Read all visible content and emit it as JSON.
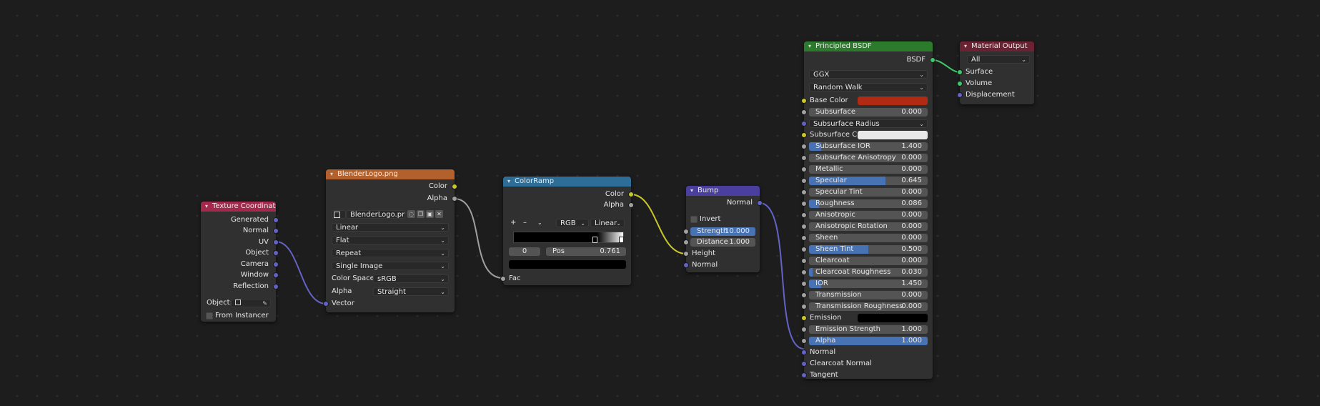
{
  "colors": {
    "background": "#1d1d1d",
    "header_input": "#a3294d",
    "header_texture": "#b3612c",
    "header_converter": "#2d6d96",
    "header_vector": "#4a3f9e",
    "header_shader": "#2c7a2c",
    "header_output": "#6b2232",
    "accent_blue": "#4772b3",
    "base_color": "#b12a14",
    "wire_gray": "#a0a0a0",
    "wire_yellow": "#c7c729",
    "wire_purple": "#6363c7",
    "wire_green": "#3fc76b"
  },
  "texcoord": {
    "title": "Texture Coordinate",
    "outputs": [
      "Generated",
      "Normal",
      "UV",
      "Object",
      "Camera",
      "Window",
      "Reflection"
    ],
    "object_label": "Object:",
    "from_instancer": "From Instancer"
  },
  "image": {
    "title": "BlenderLogo.png",
    "outputs": {
      "color": "Color",
      "alpha": "Alpha"
    },
    "image_name": "BlenderLogo.png",
    "interpolation": "Linear",
    "projection": "Flat",
    "extension": "Repeat",
    "source": "Single Image",
    "color_space_label": "Color Space",
    "color_space": "sRGB",
    "alpha_label": "Alpha",
    "alpha_mode": "Straight",
    "input_vector": "Vector"
  },
  "colorramp": {
    "title": "ColorRamp",
    "outputs": {
      "color": "Color",
      "alpha": "Alpha"
    },
    "add_icon": "+",
    "remove_icon": "–",
    "color_mode": "RGB",
    "interpolation": "Linear",
    "index": "0",
    "pos_label": "Pos",
    "pos_value": "0.761",
    "input_fac": "Fac"
  },
  "bump": {
    "title": "Bump",
    "output_normal": "Normal",
    "invert": "Invert",
    "strength_label": "Strength",
    "strength_value": "10.000",
    "distance_label": "Distance",
    "distance_value": "1.000",
    "input_height": "Height",
    "input_normal": "Normal"
  },
  "bsdf": {
    "title": "Principled BSDF",
    "output": "BSDF",
    "distribution": "GGX",
    "subsurface_method": "Random Walk",
    "base_color_label": "Base Color",
    "subsurface_radius": "Subsurface Radius",
    "subsurface_color_label": "Subsurface C...",
    "emission_label": "Emission",
    "sliders": [
      {
        "label": "Subsurface",
        "value": "0.000",
        "fill": 0.0
      },
      {
        "label": "Subsurface IOR",
        "value": "1.400",
        "fill": 0.1
      },
      {
        "label": "Subsurface Anisotropy",
        "value": "0.000",
        "fill": 0.0
      },
      {
        "label": "Metallic",
        "value": "0.000",
        "fill": 0.0
      },
      {
        "label": "Specular",
        "value": "0.645",
        "fill": 0.645
      },
      {
        "label": "Specular Tint",
        "value": "0.000",
        "fill": 0.0
      },
      {
        "label": "Roughness",
        "value": "0.086",
        "fill": 0.086
      },
      {
        "label": "Anisotropic",
        "value": "0.000",
        "fill": 0.0
      },
      {
        "label": "Anisotropic Rotation",
        "value": "0.000",
        "fill": 0.0
      },
      {
        "label": "Sheen",
        "value": "0.000",
        "fill": 0.0
      },
      {
        "label": "Sheen Tint",
        "value": "0.500",
        "fill": 0.5
      },
      {
        "label": "Clearcoat",
        "value": "0.000",
        "fill": 0.0
      },
      {
        "label": "Clearcoat Roughness",
        "value": "0.030",
        "fill": 0.03
      },
      {
        "label": "IOR",
        "value": "1.450",
        "fill": 0.1
      },
      {
        "label": "Transmission",
        "value": "0.000",
        "fill": 0.0
      },
      {
        "label": "Transmission Roughness",
        "value": "0.000",
        "fill": 0.0
      }
    ],
    "emission_strength": {
      "label": "Emission Strength",
      "value": "1.000",
      "fill": 0.0
    },
    "alpha": {
      "label": "Alpha",
      "value": "1.000",
      "fill": 1.0
    },
    "bottom_inputs": [
      "Normal",
      "Clearcoat Normal",
      "Tangent"
    ]
  },
  "output": {
    "title": "Material Output",
    "target": "All",
    "inputs": [
      "Surface",
      "Volume",
      "Displacement"
    ]
  }
}
